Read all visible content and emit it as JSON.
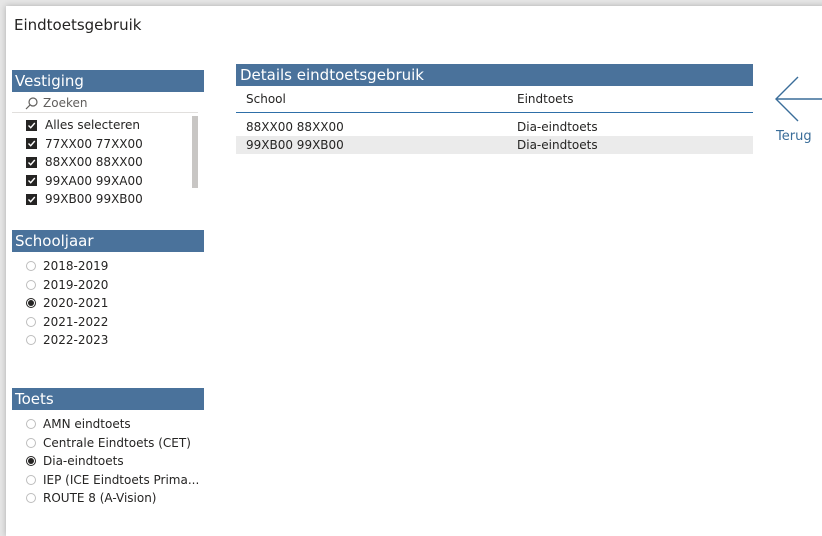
{
  "page": {
    "title": "Eindtoetsgebruik"
  },
  "colors": {
    "header": "#4a729b",
    "accent": "#2e6fa8",
    "back_arrow": "#3a6d99"
  },
  "vestiging": {
    "title": "Vestiging",
    "search_placeholder": "Zoeken",
    "items": [
      {
        "label": "Alles selecteren",
        "checked": true
      },
      {
        "label": "77XX00 77XX00",
        "checked": true
      },
      {
        "label": "88XX00 88XX00",
        "checked": true
      },
      {
        "label": "99XA00 99XA00",
        "checked": true
      },
      {
        "label": "99XB00 99XB00",
        "checked": true
      }
    ]
  },
  "schooljaar": {
    "title": "Schooljaar",
    "items": [
      {
        "label": "2018-2019",
        "selected": false
      },
      {
        "label": "2019-2020",
        "selected": false
      },
      {
        "label": "2020-2021",
        "selected": true
      },
      {
        "label": "2021-2022",
        "selected": false
      },
      {
        "label": "2022-2023",
        "selected": false
      }
    ]
  },
  "toets": {
    "title": "Toets",
    "items": [
      {
        "label": "AMN eindtoets",
        "selected": false
      },
      {
        "label": "Centrale Eindtoets (CET)",
        "selected": false
      },
      {
        "label": "Dia-eindtoets",
        "selected": true
      },
      {
        "label": "IEP (ICE Eindtoets Prima...",
        "selected": false
      },
      {
        "label": "ROUTE 8 (A-Vision)",
        "selected": false
      }
    ]
  },
  "details": {
    "title": "Details eindtoetsgebruik",
    "columns": [
      "School",
      "Eindtoets"
    ],
    "rows": [
      [
        "88XX00 88XX00",
        "Dia-eindtoets"
      ],
      [
        "99XB00 99XB00",
        "Dia-eindtoets"
      ]
    ]
  },
  "back": {
    "label": "Terug"
  }
}
